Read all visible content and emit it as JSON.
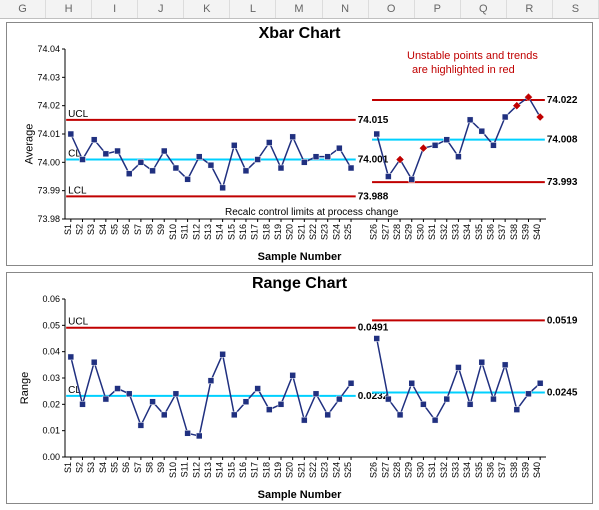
{
  "columns": [
    "G",
    "H",
    "I",
    "J",
    "K",
    "L",
    "M",
    "N",
    "O",
    "P",
    "Q",
    "R",
    "S"
  ],
  "annotations": {
    "unstable1": "Unstable points and trends",
    "unstable2": "are highlighted in red",
    "recalc": "Recalc control limits at process change",
    "ucl": "UCL",
    "cl": "CL",
    "lcl": "LCL"
  },
  "chart_data": [
    {
      "type": "line",
      "title": "Xbar Chart",
      "xlabel": "Sample Number",
      "ylabel": "Average",
      "ylim": [
        73.98,
        74.04
      ],
      "yticks": [
        73.98,
        73.99,
        74.0,
        74.01,
        74.02,
        74.03,
        74.04
      ],
      "categories": [
        "S1",
        "S2",
        "S3",
        "S4",
        "S5",
        "S6",
        "S7",
        "S8",
        "S9",
        "S10",
        "S11",
        "S12",
        "S13",
        "S14",
        "S15",
        "S16",
        "S17",
        "S18",
        "S19",
        "S20",
        "S21",
        "S22",
        "S23",
        "S24",
        "S25",
        "S26",
        "S27",
        "S28",
        "S29",
        "S30",
        "S31",
        "S32",
        "S33",
        "S34",
        "S35",
        "S36",
        "S37",
        "S38",
        "S39",
        "S40"
      ],
      "series": [
        {
          "name": "Average",
          "values": [
            74.01,
            74.001,
            74.008,
            74.003,
            74.004,
            73.996,
            74.0,
            73.997,
            74.004,
            73.998,
            73.994,
            74.002,
            73.999,
            73.991,
            74.006,
            73.997,
            74.001,
            74.007,
            73.998,
            74.009,
            74.0,
            74.002,
            74.002,
            74.005,
            73.998,
            74.01,
            73.995,
            74.001,
            73.994,
            74.005,
            74.006,
            74.008,
            74.002,
            74.015,
            74.011,
            74.006,
            74.016,
            74.02,
            74.023,
            74.016
          ]
        }
      ],
      "unstable_points": [
        28,
        30,
        38,
        39,
        40
      ],
      "segments": [
        {
          "range": [
            1,
            25
          ],
          "UCL": 74.015,
          "CL": 74.001,
          "LCL": 73.988
        },
        {
          "range": [
            26,
            40
          ],
          "UCL": 74.022,
          "CL": 74.008,
          "LCL": 73.993
        }
      ]
    },
    {
      "type": "line",
      "title": "Range Chart",
      "xlabel": "Sample Number",
      "ylabel": "Range",
      "ylim": [
        0,
        0.06
      ],
      "yticks": [
        0.0,
        0.01,
        0.02,
        0.03,
        0.04,
        0.05,
        0.06
      ],
      "categories": [
        "S1",
        "S2",
        "S3",
        "S4",
        "S5",
        "S6",
        "S7",
        "S8",
        "S9",
        "S10",
        "S11",
        "S12",
        "S13",
        "S14",
        "S15",
        "S16",
        "S17",
        "S18",
        "S19",
        "S20",
        "S21",
        "S22",
        "S23",
        "S24",
        "S25",
        "S26",
        "S27",
        "S28",
        "S29",
        "S30",
        "S31",
        "S32",
        "S33",
        "S34",
        "S35",
        "S36",
        "S37",
        "S38",
        "S39",
        "S40"
      ],
      "series": [
        {
          "name": "Range",
          "values": [
            0.038,
            0.02,
            0.036,
            0.022,
            0.026,
            0.024,
            0.012,
            0.021,
            0.016,
            0.024,
            0.009,
            0.008,
            0.029,
            0.039,
            0.016,
            0.021,
            0.026,
            0.018,
            0.02,
            0.031,
            0.014,
            0.024,
            0.016,
            0.022,
            0.028,
            0.045,
            0.022,
            0.016,
            0.028,
            0.02,
            0.014,
            0.022,
            0.034,
            0.02,
            0.036,
            0.022,
            0.035,
            0.018,
            0.024,
            0.028
          ]
        }
      ],
      "unstable_points": [],
      "segments": [
        {
          "range": [
            1,
            25
          ],
          "UCL": 0.0491,
          "CL": 0.0232,
          "LCL": null
        },
        {
          "range": [
            26,
            40
          ],
          "UCL": 0.0519,
          "CL": 0.0245,
          "LCL": null
        }
      ]
    }
  ]
}
